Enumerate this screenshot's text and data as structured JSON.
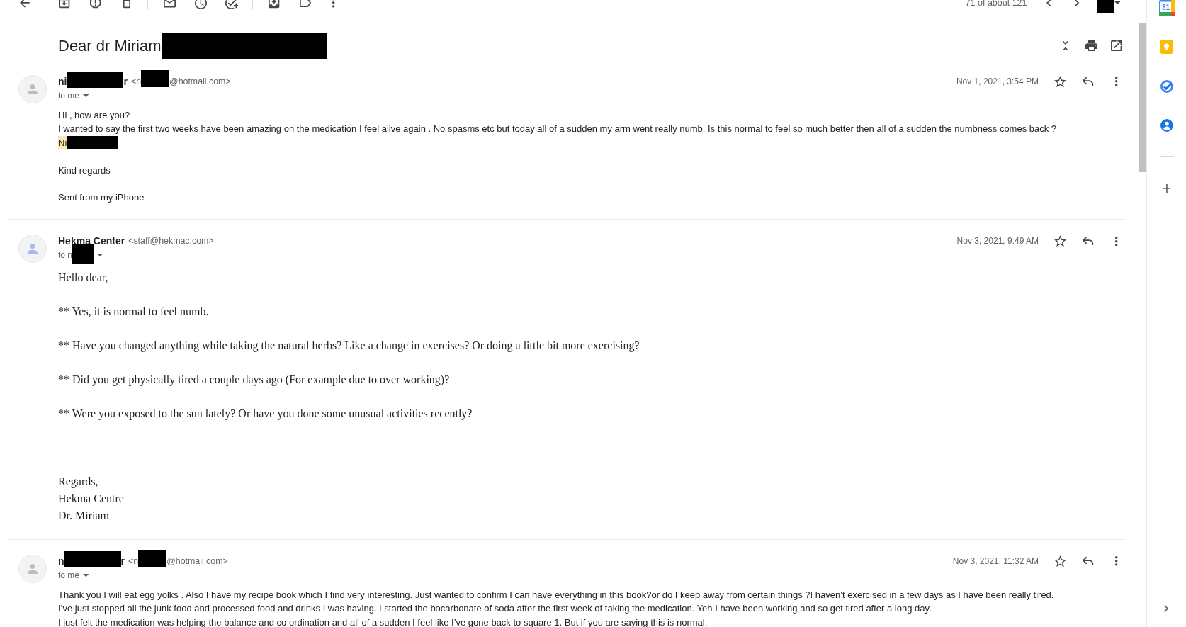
{
  "toolbar": {
    "counter": "71 of about 121",
    "input_tools": [
      {
        "kind": "redaction"
      }
    ]
  },
  "subject": [
    {
      "kind": "text",
      "text": "Dear dr Miriam"
    },
    {
      "kind": "redaction"
    }
  ],
  "messages": [
    {
      "kind": "plain",
      "avatar": {
        "color": "#bdbdbd"
      },
      "sender_name": [
        {
          "kind": "text",
          "text": "ni"
        },
        {
          "kind": "redaction"
        },
        {
          "kind": "text",
          "text": "r"
        }
      ],
      "sender_email": [
        {
          "kind": "text",
          "text": "<n"
        },
        {
          "kind": "redaction"
        },
        {
          "kind": "text",
          "text": "@hotmail.com>"
        }
      ],
      "recipient": [
        {
          "kind": "text",
          "text": "to me"
        }
      ],
      "date": "Nov 1, 2021, 3:54 PM",
      "starred": false,
      "paragraphs": [
        {
          "kind": "text",
          "lines": [
            [
              {
                "kind": "text",
                "text": "Hi , how are you?",
                "highlighted": false
              }
            ],
            [
              {
                "kind": "text",
                "text": "I wanted to say the first two weeks have been amazing on the medication I feel alive again . No spasms etc but today all of a sudden my arm went really numb. Is this normal to feel so much better then all of a sudden the numbness comes back ?",
                "highlighted": false
              }
            ],
            [
              {
                "kind": "text",
                "text": "Ni",
                "highlighted": true
              },
              {
                "kind": "redaction"
              }
            ]
          ]
        },
        {
          "kind": "text",
          "lines": [
            [
              {
                "kind": "text",
                "text": "Kind regards",
                "highlighted": false
              }
            ]
          ]
        },
        {
          "kind": "text",
          "lines": [
            [
              {
                "kind": "text",
                "text": "Sent from my iPhone",
                "highlighted": false
              }
            ]
          ]
        }
      ]
    },
    {
      "kind": "rich",
      "avatar": {
        "color": "#a3bcec"
      },
      "sender_name": [
        {
          "kind": "text",
          "text": "Hekma Center"
        }
      ],
      "sender_email": [
        {
          "kind": "text",
          "text": "<staff@hekmac.com>"
        }
      ],
      "recipient": [
        {
          "kind": "text",
          "text": "to n"
        },
        {
          "kind": "redaction"
        }
      ],
      "date": "Nov 3, 2021, 9:49 AM",
      "starred": false,
      "paragraphs": [
        {
          "kind": "text",
          "lines": [
            [
              {
                "kind": "text",
                "text": "Hello dear,",
                "highlighted": false
              }
            ]
          ]
        },
        {
          "kind": "text",
          "lines": [
            [
              {
                "kind": "text",
                "text": "** Yes, it is normal to feel numb.",
                "highlighted": false
              }
            ]
          ]
        },
        {
          "kind": "text",
          "lines": [
            [
              {
                "kind": "text",
                "text": "** Have you changed anything while taking the natural herbs? Like a change in exercises? Or doing a little bit more exercising?",
                "highlighted": false
              }
            ]
          ]
        },
        {
          "kind": "text",
          "lines": [
            [
              {
                "kind": "text",
                "text": "** Did you get physically tired a couple days ago (For example due to over working)?",
                "highlighted": false
              }
            ]
          ]
        },
        {
          "kind": "text",
          "lines": [
            [
              {
                "kind": "text",
                "text": "** Were you exposed to the sun lately? Or have you done some unusual activities recently?",
                "highlighted": false
              }
            ]
          ]
        },
        {
          "kind": "signature",
          "lines": [
            [
              {
                "kind": "text",
                "text": "Regards,",
                "highlighted": false
              }
            ],
            [
              {
                "kind": "text",
                "text": "Hekma Centre",
                "highlighted": false
              }
            ],
            [
              {
                "kind": "text",
                "text": "Dr. Miriam",
                "highlighted": false
              }
            ]
          ]
        }
      ]
    },
    {
      "kind": "plain",
      "avatar": {
        "color": "#bdbdbd"
      },
      "sender_name": [
        {
          "kind": "text",
          "text": "n"
        },
        {
          "kind": "redaction"
        },
        {
          "kind": "text",
          "text": "r"
        }
      ],
      "sender_email": [
        {
          "kind": "text",
          "text": "<n"
        },
        {
          "kind": "redaction"
        },
        {
          "kind": "text",
          "text": "@hotmail.com>"
        }
      ],
      "recipient": [
        {
          "kind": "text",
          "text": "to me"
        }
      ],
      "date": "Nov 3, 2021, 11:32 AM",
      "starred": false,
      "paragraphs": [
        {
          "kind": "text",
          "lines": [
            [
              {
                "kind": "text",
                "text": "Thank you I will eat egg yolks . Also I have my recipe book which I find very interesting. Just wanted to confirm I can have everything in this book?or do I keep away from certain things ?I haven’t exercised in a few days as I have been really tired.",
                "highlighted": false
              }
            ],
            [
              {
                "kind": "text",
                "text": "I’ve just stopped all the junk food and processed food and drinks I was having. I started the bocarbonate of soda after the first week of taking the medication. Yeh I have been working and so get tired after a long day.",
                "highlighted": false
              }
            ],
            [
              {
                "kind": "text",
                "text": "I just felt the medication was helping the balance and co ordination and all of a sudden I feel like I’ve gone back to square 1. But if you are saying this is normal.",
                "highlighted": false
              }
            ]
          ]
        }
      ]
    }
  ],
  "side_panel": {
    "calendar_date": "31"
  }
}
